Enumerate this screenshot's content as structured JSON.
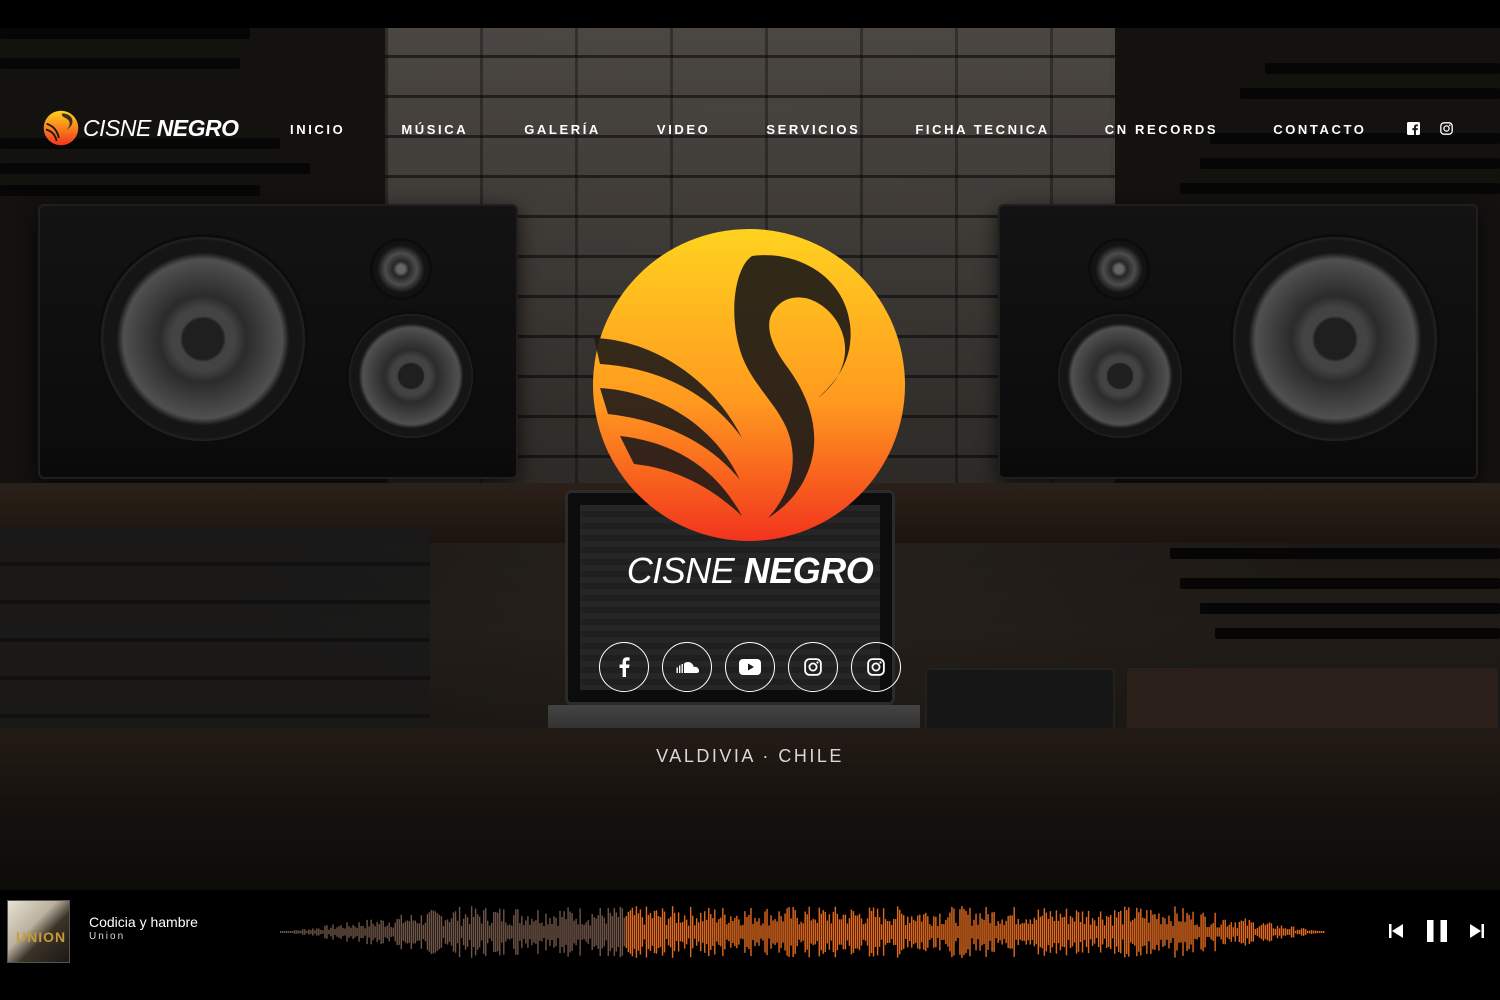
{
  "brand": {
    "name_light": "CISNE ",
    "name_bold": "NEGRO"
  },
  "nav": {
    "items": [
      "INICIO",
      "MÚSICA",
      "GALERÍA",
      "VIDEO",
      "SERVICIOS",
      "FICHA TECNICA",
      "CN RECORDS",
      "CONTACTO"
    ],
    "social": [
      "facebook-icon",
      "instagram-icon"
    ]
  },
  "hero": {
    "social": [
      "facebook-icon",
      "soundcloud-icon",
      "youtube-icon",
      "instagram-icon",
      "instagram-icon"
    ],
    "location": "VALDIVIA · CHILE"
  },
  "player": {
    "album_art_text": "UNION",
    "track_title": "Codicia y hambre",
    "track_artist": "Union",
    "progress": 0.33,
    "colors": {
      "played": "#6e5446",
      "unplayed": "#e0691e"
    },
    "controls": [
      "previous-icon",
      "pause-icon",
      "next-icon"
    ]
  },
  "colors": {
    "accent_top": "#ffd21f",
    "accent_bottom": "#f2341e",
    "background": "#000000"
  }
}
